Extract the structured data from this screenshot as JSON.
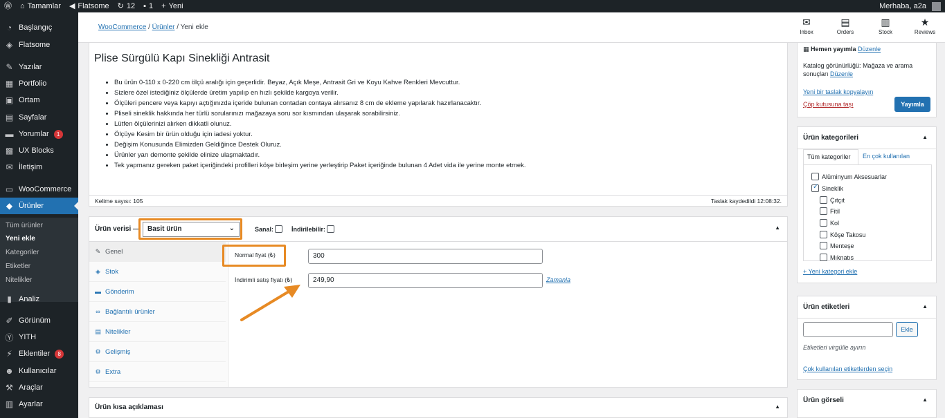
{
  "adminbar": {
    "site_name": "Tamamlar",
    "theme": "Flatsome",
    "updates_count": "12",
    "comments_count": "1",
    "new_label": "Yeni",
    "greeting": "Merhaba, a2a"
  },
  "sidebar": {
    "items": [
      {
        "label": "Başlangıç",
        "icon": "gauge-icon"
      },
      {
        "label": "Flatsome",
        "icon": "flatsome-icon"
      },
      {
        "label": "Yazılar",
        "icon": "pin-icon"
      },
      {
        "label": "Portfolio",
        "icon": "portfolio-icon"
      },
      {
        "label": "Ortam",
        "icon": "media-icon"
      },
      {
        "label": "Sayfalar",
        "icon": "pages-icon"
      },
      {
        "label": "Yorumlar",
        "icon": "comment-icon",
        "badge": "1"
      },
      {
        "label": "UX Blocks",
        "icon": "blocks-icon"
      },
      {
        "label": "İletişim",
        "icon": "mail-icon"
      },
      {
        "label": "WooCommerce",
        "icon": "woo-icon"
      },
      {
        "label": "Ürünler",
        "icon": "cube-icon"
      },
      {
        "label": "Analiz",
        "icon": "chart-icon"
      },
      {
        "label": "Görünüm",
        "icon": "brush-icon"
      },
      {
        "label": "YITH",
        "icon": "yith-icon"
      },
      {
        "label": "Eklentiler",
        "icon": "plugin-icon",
        "badge": "8"
      },
      {
        "label": "Kullanıcılar",
        "icon": "users-icon"
      },
      {
        "label": "Araçlar",
        "icon": "tools-icon"
      },
      {
        "label": "Ayarlar",
        "icon": "settings-icon"
      }
    ],
    "submenu": [
      "Tüm ürünler",
      "Yeni ekle",
      "Kategoriler",
      "Etiketler",
      "Nitelikler"
    ]
  },
  "breadcrumb": {
    "woocommerce": "WooCommerce",
    "products": "Ürünler",
    "current": "Yeni ekle",
    "sep": "/"
  },
  "wc_toolbar": {
    "inbox": "Inbox",
    "orders": "Orders",
    "stock": "Stock",
    "reviews": "Reviews"
  },
  "product": {
    "title": "Plise Sürgülü Kapı Sinekliği Antrasit",
    "description": [
      "Bu ürün 0-110 x 0-220 cm ölçü aralığı için geçerlidir. Beyaz, Açık Meşe, Antrasit Gri ve Koyu Kahve Renkleri Mevcuttur.",
      "Sizlere özel istediğiniz ölçülerde üretim yapılıp en hızlı şekilde kargoya verilir.",
      "Ölçüleri pencere veya kapıyı açtığınızda içeride bulunan contadan contaya alırsanız 8 cm de ekleme yapılarak hazırlanacaktır.",
      "Pliseli sineklik hakkında her türlü sorularınızı mağazaya soru sor kısmından ulaşarak sorabilirsiniz.",
      "Lütfen ölçülerinizi alırken dikkatli olunuz.",
      "Ölçüye Kesim bir ürün olduğu için iadesi yoktur.",
      "Değişim Konusunda Elimizden Geldiğince Destek Oluruz.",
      "Ürünler yarı demonte şekilde elinize ulaşmaktadır.",
      "Tek yapmanız gereken paket içeriğindeki profilleri köşe birleşim yerine yerleştirip Paket içeriğinde bulunan 4 Adet vida ile yerine monte etmek."
    ],
    "word_count": "Kelime sayısı: 105",
    "draft_saved": "Taslak kaydedildi 12:08:32."
  },
  "product_data": {
    "label": "Ürün verisi —",
    "type_value": "Basit ürün",
    "virtual_label": "Sanal:",
    "downloadable_label": "İndirilebilir:",
    "tabs": [
      {
        "label": "Genel",
        "icon": "wrench-icon"
      },
      {
        "label": "Stok",
        "icon": "tag-icon"
      },
      {
        "label": "Gönderim",
        "icon": "truck-icon"
      },
      {
        "label": "Bağlantılı ürünler",
        "icon": "link-icon"
      },
      {
        "label": "Nitelikler",
        "icon": "list-icon"
      },
      {
        "label": "Gelişmiş",
        "icon": "gear-icon"
      },
      {
        "label": "Extra",
        "icon": "extra-icon"
      }
    ],
    "regular_price_label": "Normal fiyat (₺)",
    "regular_price_value": "300",
    "sale_price_label": "İndirimli satış fiyatı (₺)",
    "sale_price_value": "249,90",
    "schedule_link": "Zamanla"
  },
  "short_description": {
    "label": "Ürün kısa açıklaması"
  },
  "publish_box": {
    "status": "Hemen yayımla",
    "edit": "Düzenle",
    "catalog_line1": "Katalog görünürlüğü: Mağaza ve arama",
    "catalog_line2": "sonuçları",
    "catalog_edit": "Düzenle",
    "copy_draft": "Yeni bir taslak kopyalayın",
    "trash": "Çöp kutusuna taşı",
    "publish_button": "Yayımla"
  },
  "categories_box": {
    "title": "Ürün kategorileri",
    "tab_all": "Tüm kategoriler",
    "tab_popular": "En çok kullanılan",
    "items": [
      {
        "label": "Alüminyum Aksesuarlar",
        "checked": false,
        "child": false
      },
      {
        "label": "Sineklik",
        "checked": true,
        "child": false
      },
      {
        "label": "Çıtçıt",
        "checked": false,
        "child": true
      },
      {
        "label": "Fitil",
        "checked": false,
        "child": true
      },
      {
        "label": "Kol",
        "checked": false,
        "child": true
      },
      {
        "label": "Köşe Takosu",
        "checked": false,
        "child": true
      },
      {
        "label": "Menteşe",
        "checked": false,
        "child": true
      },
      {
        "label": "Mıknatıs",
        "checked": false,
        "child": true
      }
    ],
    "add_new": "+ Yeni kategori ekle"
  },
  "tags_box": {
    "title": "Ürün etiketleri",
    "add_button": "Ekle",
    "hint": "Etiketleri virgülle ayırın",
    "popular_link": "Çok kullanılan etiketlerden seçin"
  },
  "image_box": {
    "title": "Ürün görseli"
  },
  "colors": {
    "admin_dark": "#1d2327",
    "accent": "#2271b1",
    "highlight": "#e78a24"
  }
}
